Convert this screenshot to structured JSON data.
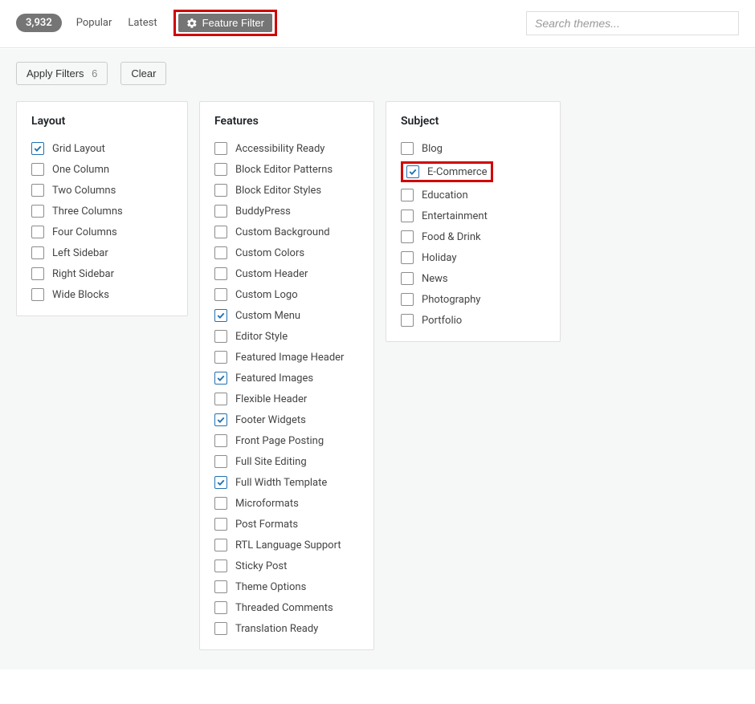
{
  "header": {
    "count": "3,932",
    "tabs": {
      "popular": "Popular",
      "latest": "Latest"
    },
    "feature_filter_label": "Feature Filter",
    "search_placeholder": "Search themes..."
  },
  "actions": {
    "apply": "Apply Filters",
    "apply_count": "6",
    "clear": "Clear"
  },
  "panel_titles": {
    "layout": "Layout",
    "features": "Features",
    "subject": "Subject"
  },
  "layout_items": [
    {
      "label": "Grid Layout",
      "checked": true
    },
    {
      "label": "One Column",
      "checked": false
    },
    {
      "label": "Two Columns",
      "checked": false
    },
    {
      "label": "Three Columns",
      "checked": false
    },
    {
      "label": "Four Columns",
      "checked": false
    },
    {
      "label": "Left Sidebar",
      "checked": false
    },
    {
      "label": "Right Sidebar",
      "checked": false
    },
    {
      "label": "Wide Blocks",
      "checked": false
    }
  ],
  "features_items": [
    {
      "label": "Accessibility Ready",
      "checked": false
    },
    {
      "label": "Block Editor Patterns",
      "checked": false
    },
    {
      "label": "Block Editor Styles",
      "checked": false
    },
    {
      "label": "BuddyPress",
      "checked": false
    },
    {
      "label": "Custom Background",
      "checked": false
    },
    {
      "label": "Custom Colors",
      "checked": false
    },
    {
      "label": "Custom Header",
      "checked": false
    },
    {
      "label": "Custom Logo",
      "checked": false
    },
    {
      "label": "Custom Menu",
      "checked": true
    },
    {
      "label": "Editor Style",
      "checked": false
    },
    {
      "label": "Featured Image Header",
      "checked": false
    },
    {
      "label": "Featured Images",
      "checked": true
    },
    {
      "label": "Flexible Header",
      "checked": false
    },
    {
      "label": "Footer Widgets",
      "checked": true
    },
    {
      "label": "Front Page Posting",
      "checked": false
    },
    {
      "label": "Full Site Editing",
      "checked": false
    },
    {
      "label": "Full Width Template",
      "checked": true
    },
    {
      "label": "Microformats",
      "checked": false
    },
    {
      "label": "Post Formats",
      "checked": false
    },
    {
      "label": "RTL Language Support",
      "checked": false
    },
    {
      "label": "Sticky Post",
      "checked": false
    },
    {
      "label": "Theme Options",
      "checked": false
    },
    {
      "label": "Threaded Comments",
      "checked": false
    },
    {
      "label": "Translation Ready",
      "checked": false
    }
  ],
  "subject_items": [
    {
      "label": "Blog",
      "checked": false,
      "highlight": false
    },
    {
      "label": "E-Commerce",
      "checked": true,
      "highlight": true
    },
    {
      "label": "Education",
      "checked": false,
      "highlight": false
    },
    {
      "label": "Entertainment",
      "checked": false,
      "highlight": false
    },
    {
      "label": "Food & Drink",
      "checked": false,
      "highlight": false
    },
    {
      "label": "Holiday",
      "checked": false,
      "highlight": false
    },
    {
      "label": "News",
      "checked": false,
      "highlight": false
    },
    {
      "label": "Photography",
      "checked": false,
      "highlight": false
    },
    {
      "label": "Portfolio",
      "checked": false,
      "highlight": false
    }
  ]
}
